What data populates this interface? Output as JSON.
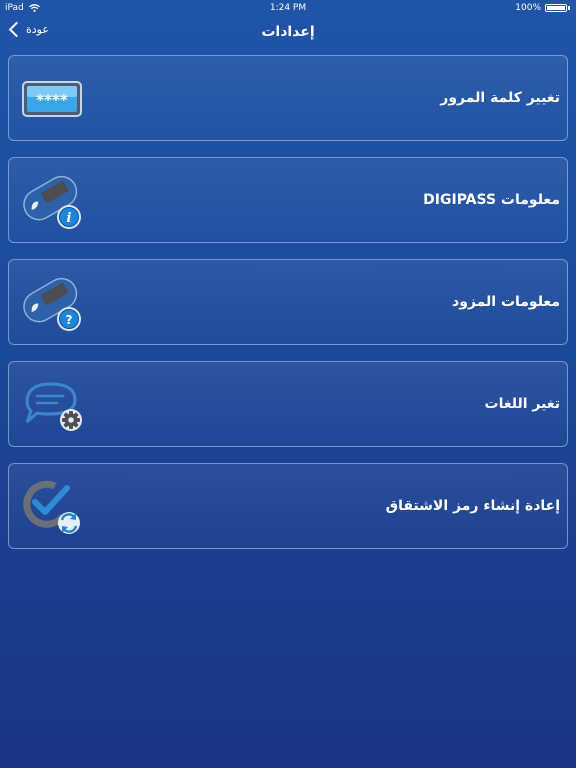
{
  "status_bar": {
    "device": "iPad",
    "time": "1:24 PM",
    "battery": "100%"
  },
  "nav": {
    "title": "إعدادات",
    "back_label": "عودة"
  },
  "rows": [
    {
      "label": "تغيير كلمة المرور",
      "icon": "password-icon"
    },
    {
      "label": "معلومات DIGIPASS",
      "icon": "digipass-info-icon"
    },
    {
      "label": "معلومات المزود",
      "icon": "provider-info-icon"
    },
    {
      "label": "تغير اللغات",
      "icon": "language-settings-icon"
    },
    {
      "label": "إعادة إنشاء رمز الاشتقاق",
      "icon": "regenerate-code-icon"
    }
  ],
  "colors": {
    "background": "#1d4ea0",
    "accent": "#2e8bd6"
  }
}
